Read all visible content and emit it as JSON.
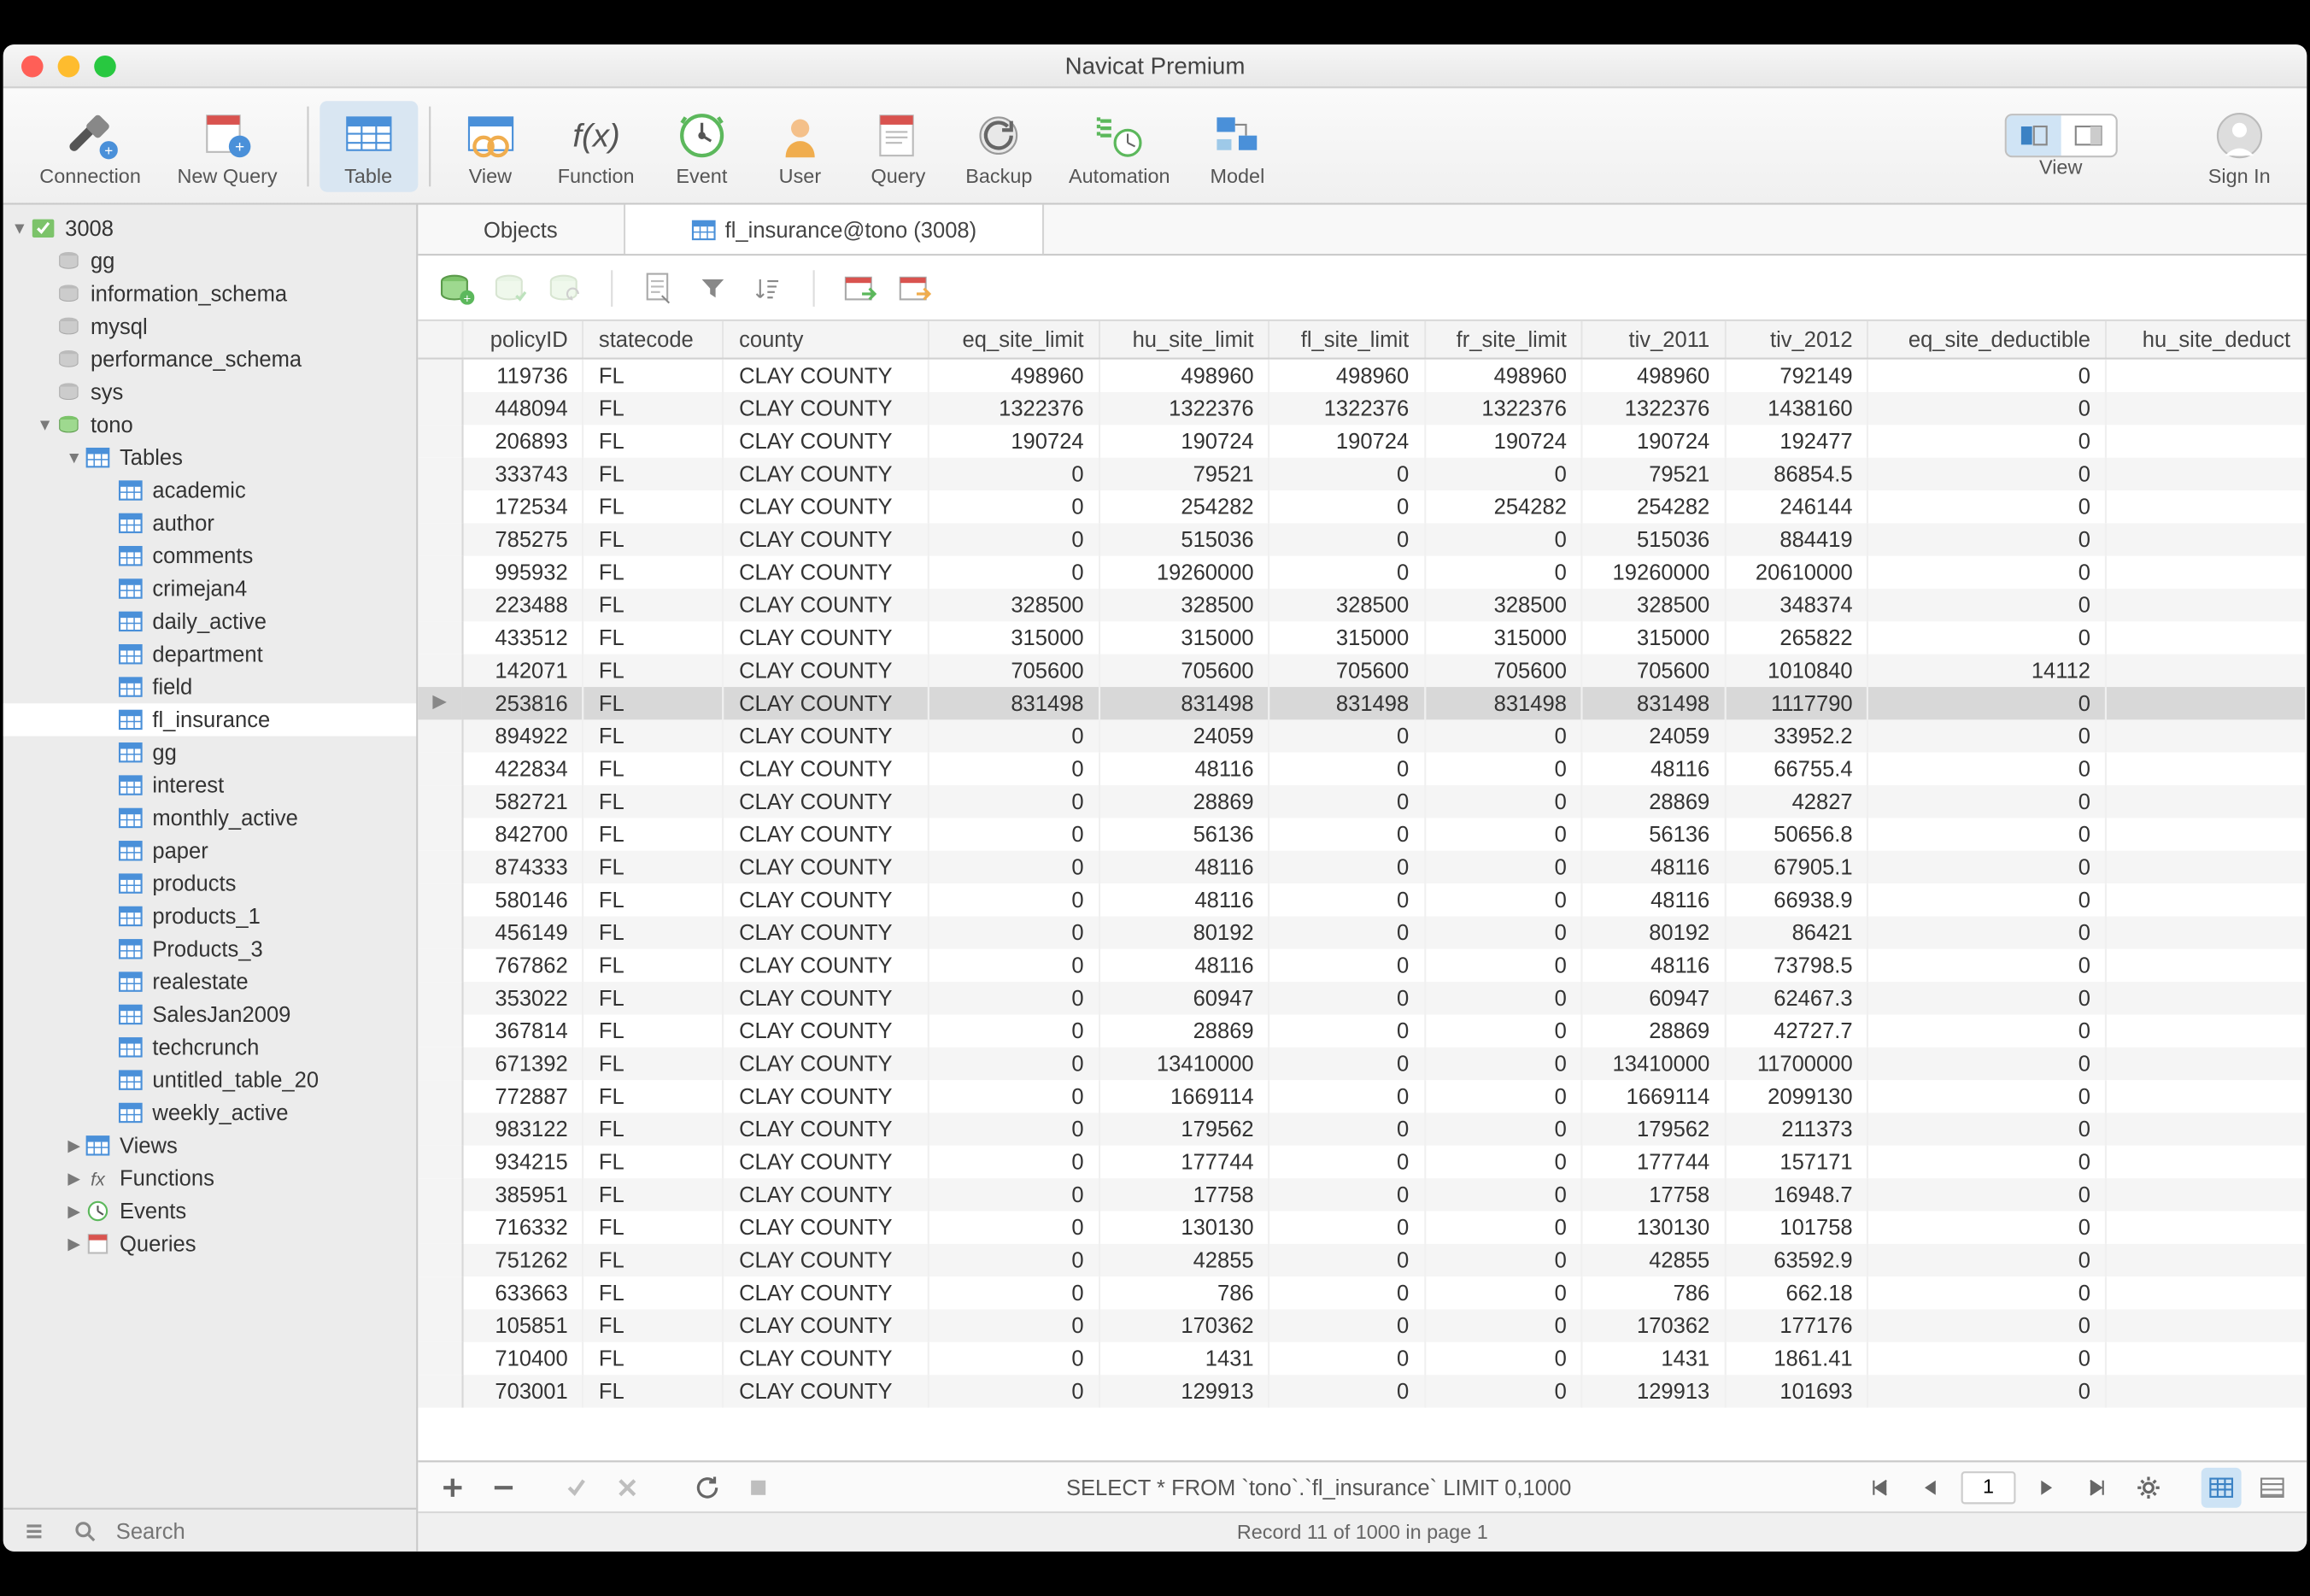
{
  "title": "Navicat Premium",
  "toolbar": {
    "items": [
      {
        "label": "Connection",
        "id": "connection"
      },
      {
        "label": "New Query",
        "id": "new-query"
      },
      {
        "label": "Table",
        "id": "table",
        "selected": true
      },
      {
        "label": "View",
        "id": "view"
      },
      {
        "label": "Function",
        "id": "function"
      },
      {
        "label": "Event",
        "id": "event"
      },
      {
        "label": "User",
        "id": "user"
      },
      {
        "label": "Query",
        "id": "query"
      },
      {
        "label": "Backup",
        "id": "backup"
      },
      {
        "label": "Automation",
        "id": "automation"
      },
      {
        "label": "Model",
        "id": "model"
      }
    ],
    "view_label": "View",
    "signin": "Sign In"
  },
  "sidebar": {
    "search_placeholder": "Search",
    "connection": "3008",
    "databases": [
      {
        "name": "gg"
      },
      {
        "name": "information_schema"
      },
      {
        "name": "mysql"
      },
      {
        "name": "performance_schema"
      },
      {
        "name": "sys"
      },
      {
        "name": "tono",
        "open": true
      }
    ],
    "tono_sections": {
      "tables_label": "Tables",
      "tables": [
        "academic",
        "author",
        "comments",
        "crimejan4",
        "daily_active",
        "department",
        "field",
        "fl_insurance",
        "gg",
        "interest",
        "monthly_active",
        "paper",
        "products",
        "products_1",
        "Products_3",
        "realestate",
        "SalesJan2009",
        "techcrunch",
        "untitled_table_20",
        "weekly_active"
      ],
      "selected_table": "fl_insurance",
      "other": [
        {
          "label": "Views",
          "icon": "views"
        },
        {
          "label": "Functions",
          "icon": "fx"
        },
        {
          "label": "Events",
          "icon": "events"
        },
        {
          "label": "Queries",
          "icon": "queries",
          "truncated": true
        }
      ]
    }
  },
  "tabs": [
    {
      "label": "Objects",
      "id": "objects"
    },
    {
      "label": "fl_insurance@tono (3008)",
      "id": "fl-insurance",
      "active": true,
      "icon": "table"
    }
  ],
  "columns": [
    "policyID",
    "statecode",
    "county",
    "eq_site_limit",
    "hu_site_limit",
    "fl_site_limit",
    "fr_site_limit",
    "tiv_2011",
    "tiv_2012",
    "eq_site_deductible",
    "hu_site_deduct"
  ],
  "column_align": [
    "num",
    "",
    "",
    "num",
    "num",
    "num",
    "num",
    "num",
    "num",
    "num",
    "num"
  ],
  "rows": [
    [
      119736,
      "FL",
      "CLAY COUNTY",
      498960,
      498960,
      498960,
      498960,
      498960,
      792149,
      0,
      ""
    ],
    [
      448094,
      "FL",
      "CLAY COUNTY",
      1322376,
      1322376,
      1322376,
      1322376,
      1322376,
      1438160,
      0,
      ""
    ],
    [
      206893,
      "FL",
      "CLAY COUNTY",
      190724,
      190724,
      190724,
      190724,
      190724,
      192477,
      0,
      ""
    ],
    [
      333743,
      "FL",
      "CLAY COUNTY",
      0,
      79521,
      0,
      0,
      79521,
      86854.5,
      0,
      ""
    ],
    [
      172534,
      "FL",
      "CLAY COUNTY",
      0,
      254282,
      0,
      254282,
      254282,
      246144,
      0,
      ""
    ],
    [
      785275,
      "FL",
      "CLAY COUNTY",
      0,
      515036,
      0,
      0,
      515036,
      884419,
      0,
      ""
    ],
    [
      995932,
      "FL",
      "CLAY COUNTY",
      0,
      19260000,
      0,
      0,
      19260000,
      20610000,
      0,
      ""
    ],
    [
      223488,
      "FL",
      "CLAY COUNTY",
      328500,
      328500,
      328500,
      328500,
      328500,
      348374,
      0,
      ""
    ],
    [
      433512,
      "FL",
      "CLAY COUNTY",
      315000,
      315000,
      315000,
      315000,
      315000,
      265822,
      0,
      ""
    ],
    [
      142071,
      "FL",
      "CLAY COUNTY",
      705600,
      705600,
      705600,
      705600,
      705600,
      1010840,
      14112,
      ""
    ],
    [
      253816,
      "FL",
      "CLAY COUNTY",
      831498,
      831498,
      831498,
      831498,
      831498,
      1117790,
      0,
      ""
    ],
    [
      894922,
      "FL",
      "CLAY COUNTY",
      0,
      24059,
      0,
      0,
      24059,
      33952.2,
      0,
      ""
    ],
    [
      422834,
      "FL",
      "CLAY COUNTY",
      0,
      48116,
      0,
      0,
      48116,
      66755.4,
      0,
      ""
    ],
    [
      582721,
      "FL",
      "CLAY COUNTY",
      0,
      28869,
      0,
      0,
      28869,
      42827,
      0,
      ""
    ],
    [
      842700,
      "FL",
      "CLAY COUNTY",
      0,
      56136,
      0,
      0,
      56136,
      50656.8,
      0,
      ""
    ],
    [
      874333,
      "FL",
      "CLAY COUNTY",
      0,
      48116,
      0,
      0,
      48116,
      67905.1,
      0,
      ""
    ],
    [
      580146,
      "FL",
      "CLAY COUNTY",
      0,
      48116,
      0,
      0,
      48116,
      66938.9,
      0,
      ""
    ],
    [
      456149,
      "FL",
      "CLAY COUNTY",
      0,
      80192,
      0,
      0,
      80192,
      86421,
      0,
      ""
    ],
    [
      767862,
      "FL",
      "CLAY COUNTY",
      0,
      48116,
      0,
      0,
      48116,
      73798.5,
      0,
      ""
    ],
    [
      353022,
      "FL",
      "CLAY COUNTY",
      0,
      60947,
      0,
      0,
      60947,
      62467.3,
      0,
      ""
    ],
    [
      367814,
      "FL",
      "CLAY COUNTY",
      0,
      28869,
      0,
      0,
      28869,
      42727.7,
      0,
      ""
    ],
    [
      671392,
      "FL",
      "CLAY COUNTY",
      0,
      13410000,
      0,
      0,
      13410000,
      11700000,
      0,
      ""
    ],
    [
      772887,
      "FL",
      "CLAY COUNTY",
      0,
      1669114,
      0,
      0,
      1669114,
      2099130,
      0,
      ""
    ],
    [
      983122,
      "FL",
      "CLAY COUNTY",
      0,
      179562,
      0,
      0,
      179562,
      211373,
      0,
      ""
    ],
    [
      934215,
      "FL",
      "CLAY COUNTY",
      0,
      177744,
      0,
      0,
      177744,
      157171,
      0,
      ""
    ],
    [
      385951,
      "FL",
      "CLAY COUNTY",
      0,
      17758,
      0,
      0,
      17758,
      16948.7,
      0,
      ""
    ],
    [
      716332,
      "FL",
      "CLAY COUNTY",
      0,
      130130,
      0,
      0,
      130130,
      101758,
      0,
      ""
    ],
    [
      751262,
      "FL",
      "CLAY COUNTY",
      0,
      42855,
      0,
      0,
      42855,
      63592.9,
      0,
      ""
    ],
    [
      633663,
      "FL",
      "CLAY COUNTY",
      0,
      786,
      0,
      0,
      786,
      662.18,
      0,
      ""
    ],
    [
      105851,
      "FL",
      "CLAY COUNTY",
      0,
      170362,
      0,
      0,
      170362,
      177176,
      0,
      ""
    ],
    [
      710400,
      "FL",
      "CLAY COUNTY",
      0,
      1431,
      0,
      0,
      1431,
      1861.41,
      0,
      ""
    ],
    [
      703001,
      "FL",
      "CLAY COUNTY",
      0,
      129913,
      0,
      0,
      129913,
      101693,
      0,
      ""
    ]
  ],
  "selected_row_index": 10,
  "footer": {
    "sql": "SELECT * FROM `tono`.`fl_insurance` LIMIT 0,1000",
    "page": "1"
  },
  "status": "Record 11 of 1000 in page 1"
}
